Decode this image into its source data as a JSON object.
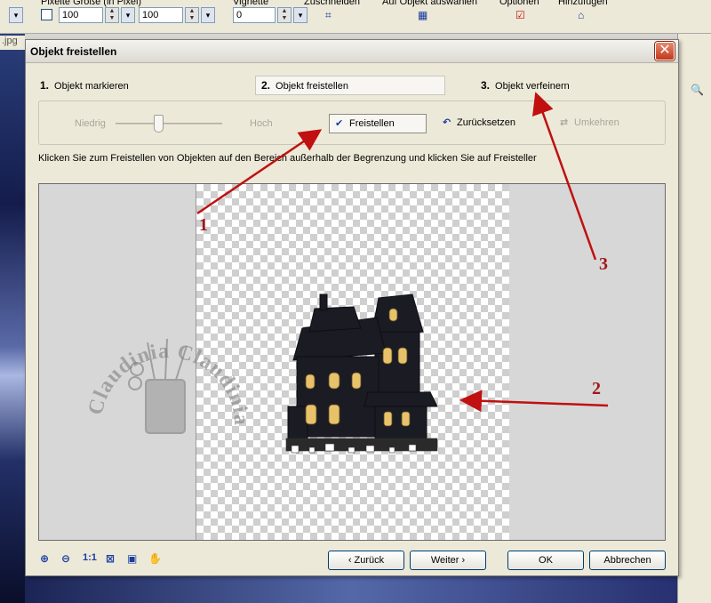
{
  "background_app": {
    "toolbar": {
      "pixel_size_label": "Pixelte Größe (in Pixel)",
      "width_value": "100",
      "height_value": "100",
      "vignette_label": "Vignette",
      "vignette_value": "0",
      "crop_label": "Zuschneiden",
      "select_object_label": "Auf Objekt auswählen",
      "options_label": "Optionen",
      "add_label": "Hinzufügen"
    },
    "left_tab_label": ".jpg"
  },
  "dialog": {
    "title": "Objekt freistellen",
    "close_symbol": "✕",
    "steps": [
      {
        "num": "1.",
        "label": "Objekt markieren",
        "active": false
      },
      {
        "num": "2.",
        "label": "Objekt freistellen",
        "active": true
      },
      {
        "num": "3.",
        "label": "Objekt verfeinern",
        "active": false
      }
    ],
    "slider": {
      "low_label": "Niedrig",
      "high_label": "Hoch",
      "value": 0.4
    },
    "tools": {
      "cutout_label": "Freistellen",
      "reset_label": "Zurücksetzen",
      "invert_label": "Umkehren"
    },
    "instruction": "Klicken Sie zum Freistellen von Objekten auf den Bereich außerhalb der Begrenzung und klicken Sie auf Freisteller",
    "watermark_text": "Claudinia Claudinia",
    "zoom_tools": [
      "zoom-in-icon",
      "zoom-out-icon",
      "actual-size-icon",
      "fit-window-icon",
      "fit-selection-icon",
      "hand-tool-icon"
    ],
    "zoom_actual_label": "1:1",
    "buttons": {
      "back": "‹ Zurück",
      "next": "Weiter ›",
      "ok": "OK",
      "cancel": "Abbrechen"
    }
  },
  "annotations": {
    "labels": [
      "1",
      "2",
      "3"
    ],
    "color": "#c01010"
  }
}
